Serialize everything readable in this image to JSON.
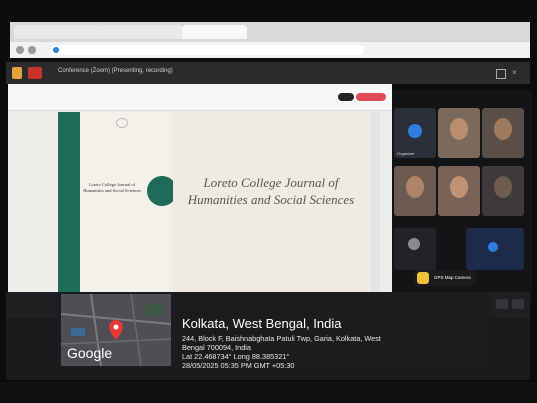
{
  "zoom": {
    "window_title": "Conference (Zoom) (Presenting, recording)",
    "participants": [
      {
        "name": "Organizer"
      },
      {
        "name": ""
      },
      {
        "name": ""
      },
      {
        "name": ""
      },
      {
        "name": ""
      },
      {
        "name": ""
      },
      {
        "name": ""
      },
      {
        "name": ""
      }
    ]
  },
  "document": {
    "journal_title": "Loreto College Journal of Humanities and Social Sciences",
    "cover_title": "Loreto College Journal of Humanities and Social Sciences"
  },
  "geotag": {
    "badge": "GPS Map Camera",
    "map_brand": "Google",
    "city": "Kolkata, West Bengal, India",
    "address_line1": "244, Block F, Baishnabghata Patuli Twp, Garia, Kolkata, West",
    "address_line2": "Bengal 700094, India",
    "coords": "Lat 22.468734° Long 88.385321°",
    "datetime": "28/05/2025 05:35 PM GMT +05:30"
  },
  "colors": {
    "cover_green": "#1e6b57",
    "pin_red": "#e53935",
    "accent_blue": "#2f7de1"
  }
}
